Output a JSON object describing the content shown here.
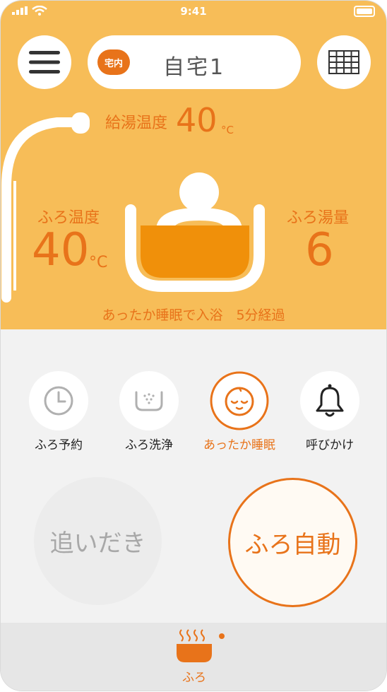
{
  "status_bar": {
    "time": "9:41"
  },
  "header": {
    "location_badge": "宅内",
    "location_name": "自宅1",
    "menu_icon": "hamburger-menu-icon",
    "grid_icon": "keypad-grid-icon"
  },
  "hero": {
    "supply_temp_label": "給湯温度",
    "supply_temp_value": "40",
    "supply_temp_unit": "°C",
    "bath_temp_label": "ふろ温度",
    "bath_temp_value": "40",
    "bath_temp_unit": "°C",
    "bath_volume_label": "ふろ湯量",
    "bath_volume_value": "6",
    "status_text": "あったか睡眠で入浴　5分経過"
  },
  "functions": [
    {
      "label": "ふろ予約",
      "icon": "clock-icon",
      "active": false
    },
    {
      "label": "ふろ洗浄",
      "icon": "tub-wash-icon",
      "active": false
    },
    {
      "label": "あったか睡眠",
      "icon": "sleeping-face-icon",
      "active": true
    },
    {
      "label": "呼びかけ",
      "icon": "bell-icon",
      "active": false
    }
  ],
  "actions": {
    "reheat_label": "追いだき",
    "auto_label": "ふろ自動"
  },
  "bottom_nav": {
    "bath_label": "ふろ"
  },
  "colors": {
    "accent": "#e8731a",
    "hero_bg": "#f7bd58",
    "water": "#f0900a"
  }
}
